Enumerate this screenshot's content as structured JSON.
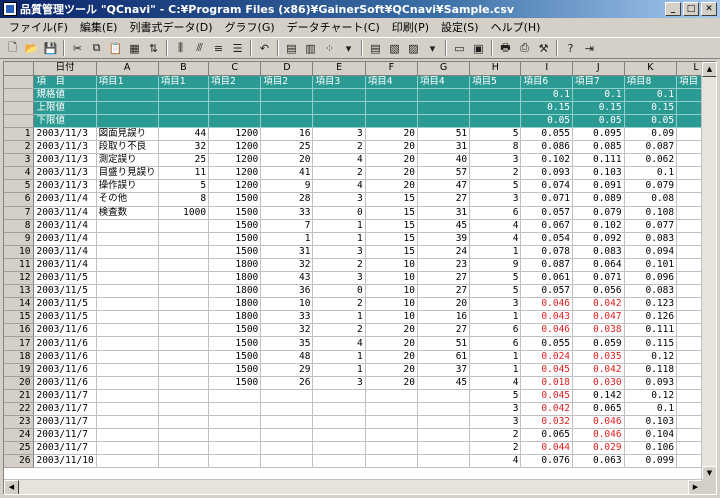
{
  "window": {
    "title": "品質管理ツール \"QCnavi\" - C:¥Program Files (x86)¥GainerSoft¥QCnavi¥Sample.csv"
  },
  "menu": [
    "ファイル(F)",
    "編集(E)",
    "列書式データ(D)",
    "グラフ(G)",
    "データチャート(C)",
    "印刷(P)",
    "設定(S)",
    "ヘルプ(H)"
  ],
  "columns": [
    "日付",
    "A",
    "B",
    "C",
    "D",
    "E",
    "F",
    "G",
    "H",
    "I",
    "J",
    "K",
    "L"
  ],
  "header_rows": [
    [
      "項　目",
      "項目1",
      "項目1",
      "項目2",
      "項目2",
      "項目3",
      "項目4",
      "項目4",
      "項目5",
      "項目6",
      "項目7",
      "項目8",
      "項目"
    ],
    [
      "規格値",
      "",
      "",
      "",
      "",
      "",
      "",
      "",
      "",
      "0.1",
      "0.1",
      "0.1",
      ""
    ],
    [
      "上限値",
      "",
      "",
      "",
      "",
      "",
      "",
      "",
      "",
      "0.15",
      "0.15",
      "0.15",
      ""
    ],
    [
      "下限値",
      "",
      "",
      "",
      "",
      "",
      "",
      "",
      "",
      "0.05",
      "0.05",
      "0.05",
      ""
    ]
  ],
  "rows": [
    [
      "1",
      "2003/11/3",
      "図面見誤り",
      "44",
      "1200",
      "16",
      "3",
      "20",
      "51",
      "5",
      "0.055",
      "0.095",
      "0.09"
    ],
    [
      "2",
      "2003/11/3",
      "段取り不良",
      "32",
      "1200",
      "25",
      "2",
      "20",
      "31",
      "8",
      "0.086",
      "0.085",
      "0.087"
    ],
    [
      "3",
      "2003/11/3",
      "測定誤り",
      "25",
      "1200",
      "20",
      "4",
      "20",
      "40",
      "3",
      "0.102",
      "0.111",
      "0.062"
    ],
    [
      "4",
      "2003/11/3",
      "目盛り見誤り",
      "11",
      "1200",
      "41",
      "2",
      "20",
      "57",
      "2",
      "0.093",
      "0.103",
      "0.1"
    ],
    [
      "5",
      "2003/11/3",
      "操作誤り",
      "5",
      "1200",
      "9",
      "4",
      "20",
      "47",
      "5",
      "0.074",
      "0.091",
      "0.079"
    ],
    [
      "6",
      "2003/11/4",
      "その他",
      "8",
      "1500",
      "28",
      "3",
      "15",
      "27",
      "3",
      "0.071",
      "0.089",
      "0.08"
    ],
    [
      "7",
      "2003/11/4",
      "検査数",
      "1000",
      "1500",
      "33",
      "0",
      "15",
      "31",
      "6",
      "0.057",
      "0.079",
      "0.108"
    ],
    [
      "8",
      "2003/11/4",
      "",
      "",
      "1500",
      "7",
      "1",
      "15",
      "45",
      "4",
      "0.067",
      "0.102",
      "0.077"
    ],
    [
      "9",
      "2003/11/4",
      "",
      "",
      "1500",
      "1",
      "1",
      "15",
      "39",
      "4",
      "0.054",
      "0.092",
      "0.083"
    ],
    [
      "10",
      "2003/11/4",
      "",
      "",
      "1500",
      "31",
      "3",
      "15",
      "24",
      "1",
      "0.078",
      "0.083",
      "0.094"
    ],
    [
      "11",
      "2003/11/4",
      "",
      "",
      "1800",
      "32",
      "2",
      "10",
      "23",
      "9",
      "0.087",
      "0.064",
      "0.101"
    ],
    [
      "12",
      "2003/11/5",
      "",
      "",
      "1800",
      "43",
      "3",
      "10",
      "27",
      "5",
      "0.061",
      "0.071",
      "0.096"
    ],
    [
      "13",
      "2003/11/5",
      "",
      "",
      "1800",
      "36",
      "0",
      "10",
      "27",
      "5",
      "0.057",
      "0.056",
      "0.083"
    ],
    [
      "14",
      "2003/11/5",
      "",
      "",
      "1800",
      "10",
      "2",
      "10",
      "20",
      "3",
      "0.046",
      "0.042",
      "0.123"
    ],
    [
      "15",
      "2003/11/5",
      "",
      "",
      "1800",
      "33",
      "1",
      "10",
      "16",
      "1",
      "0.043",
      "0.047",
      "0.126"
    ],
    [
      "16",
      "2003/11/6",
      "",
      "",
      "1500",
      "32",
      "2",
      "20",
      "27",
      "6",
      "0.046",
      "0.038",
      "0.111"
    ],
    [
      "17",
      "2003/11/6",
      "",
      "",
      "1500",
      "35",
      "4",
      "20",
      "51",
      "6",
      "0.055",
      "0.059",
      "0.115"
    ],
    [
      "18",
      "2003/11/6",
      "",
      "",
      "1500",
      "48",
      "1",
      "20",
      "61",
      "1",
      "0.024",
      "0.035",
      "0.12"
    ],
    [
      "19",
      "2003/11/6",
      "",
      "",
      "1500",
      "29",
      "1",
      "20",
      "37",
      "1",
      "0.045",
      "0.042",
      "0.118"
    ],
    [
      "20",
      "2003/11/6",
      "",
      "",
      "1500",
      "26",
      "3",
      "20",
      "45",
      "4",
      "0.018",
      "0.030",
      "0.093"
    ],
    [
      "21",
      "2003/11/7",
      "",
      "",
      "",
      "",
      "",
      "",
      "",
      "5",
      "0.045",
      "0.142",
      "0.12"
    ],
    [
      "22",
      "2003/11/7",
      "",
      "",
      "",
      "",
      "",
      "",
      "",
      "3",
      "0.042",
      "0.065",
      "0.1"
    ],
    [
      "23",
      "2003/11/7",
      "",
      "",
      "",
      "",
      "",
      "",
      "",
      "3",
      "0.032",
      "0.046",
      "0.103"
    ],
    [
      "24",
      "2003/11/7",
      "",
      "",
      "",
      "",
      "",
      "",
      "",
      "2",
      "0.065",
      "0.046",
      "0.104"
    ],
    [
      "25",
      "2003/11/7",
      "",
      "",
      "",
      "",
      "",
      "",
      "",
      "2",
      "0.044",
      "0.029",
      "0.106"
    ],
    [
      "26",
      "2003/11/10",
      "",
      "",
      "",
      "",
      "",
      "",
      "",
      "4",
      "0.076",
      "0.063",
      "0.099"
    ]
  ],
  "red_cells": [
    "14-10",
    "14-11",
    "15-10",
    "15-11",
    "16-10",
    "16-11",
    "18-10",
    "18-11",
    "19-10",
    "19-11",
    "20-10",
    "20-11",
    "21-10",
    "22-10",
    "23-10",
    "23-11",
    "24-11",
    "25-10",
    "25-11"
  ]
}
